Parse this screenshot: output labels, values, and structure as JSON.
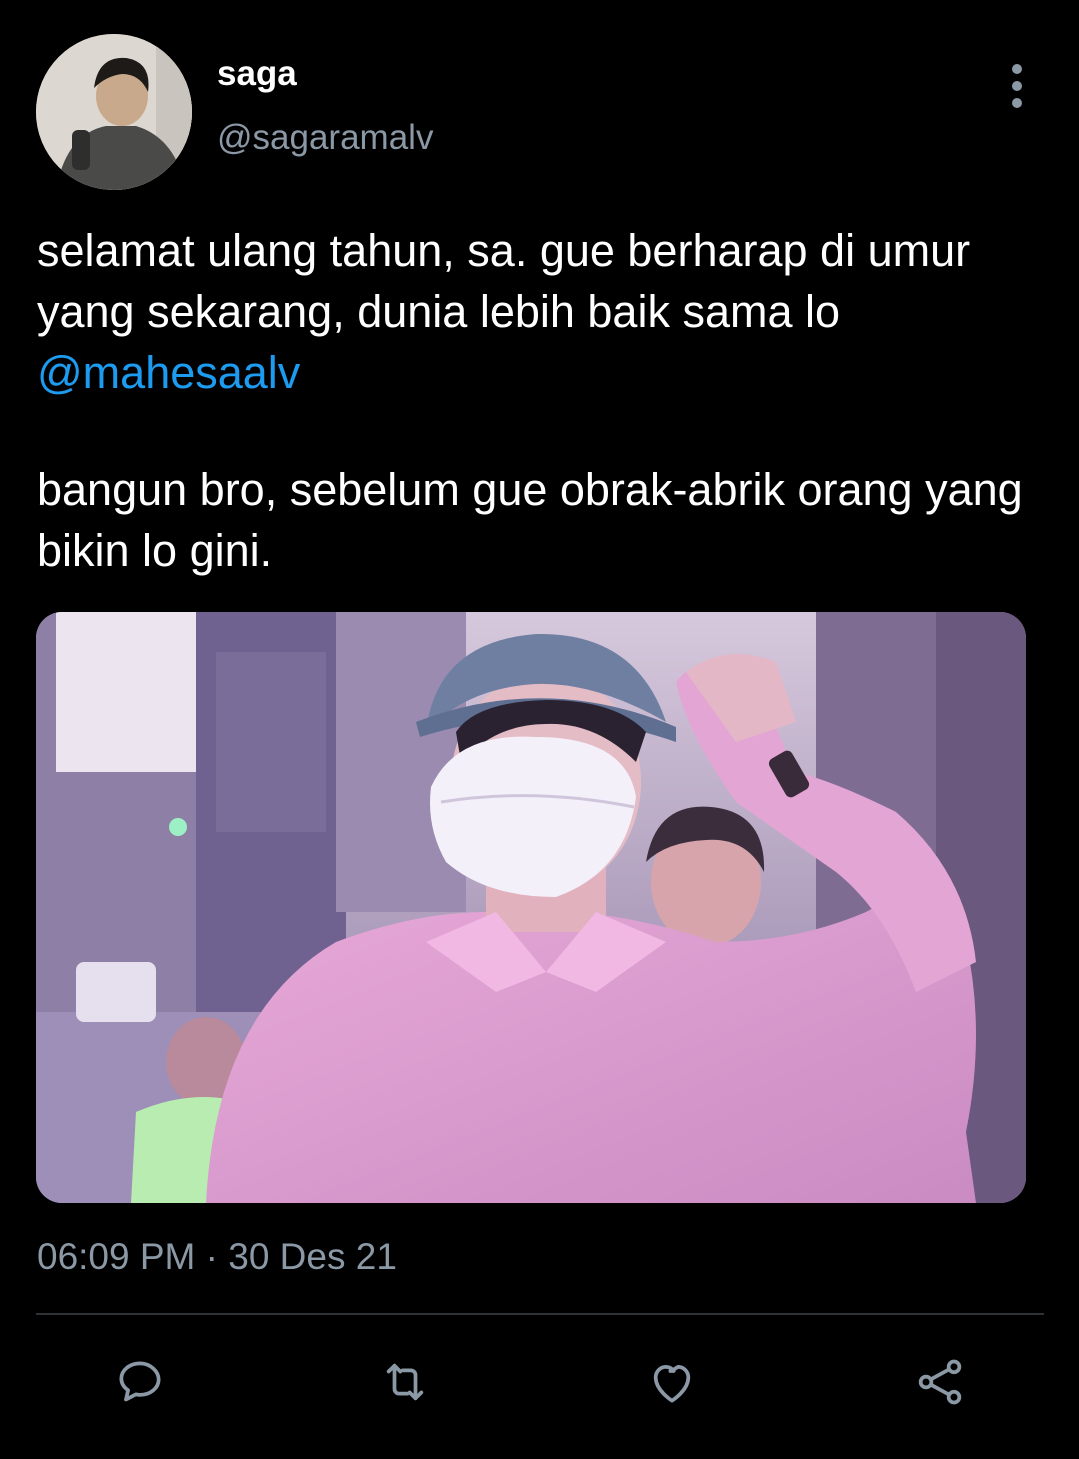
{
  "author": {
    "display_name": "saga",
    "handle": "@sagaramalv"
  },
  "tweet": {
    "line1_text": "selamat ulang tahun, sa. gue berharap di umur yang sekarang, dunia lebih baik sama lo ",
    "mention": "@mahesaalv",
    "line2_text": "bangun bro, sebelum gue obrak-abrik orang yang bikin lo gini.",
    "timestamp": "06:09 PM · 30 Des 21"
  },
  "actions": {
    "reply_icon": "reply-icon",
    "retweet_icon": "retweet-icon",
    "like_icon": "heart-icon",
    "share_icon": "share-icon"
  },
  "colors": {
    "background": "#000000",
    "text": "#ffffff",
    "secondary": "#8b98a5",
    "link": "#1d9bf0",
    "divider": "#2f3336"
  }
}
